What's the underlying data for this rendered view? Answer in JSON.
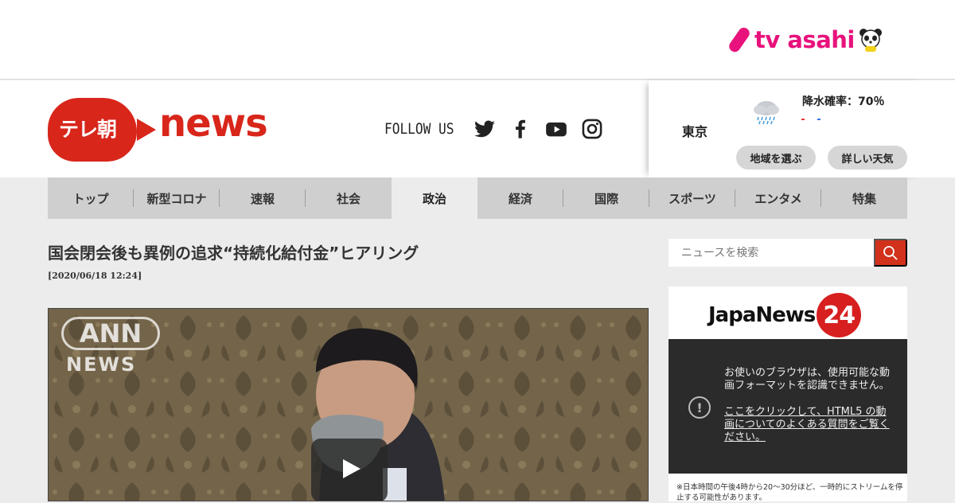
{
  "brand": {
    "tv_asahi": "tv asahi",
    "logo_blob": "テレ朝",
    "logo_news": "news"
  },
  "header": {
    "follow_us": "FOLLOW US",
    "social": [
      "twitter-icon",
      "facebook-icon",
      "youtube-icon",
      "instagram-icon"
    ]
  },
  "weather": {
    "city": "東京",
    "rain_probability": "降水確率：70％",
    "icon": "rain-cloud-icon",
    "select_region": "地域を選ぶ",
    "detail_weather": "詳しい天気"
  },
  "nav": {
    "items": [
      "トップ",
      "新型コロナ",
      "速報",
      "社会",
      "政治",
      "経済",
      "国際",
      "スポーツ",
      "エンタメ",
      "特集"
    ],
    "active": "政治"
  },
  "article": {
    "title": "国会閉会後も異例の追求“持続化給付金”ヒアリング",
    "date": "[2020/06/18 12:24]",
    "video_watermark_1": "ANN",
    "video_watermark_2": "NEWS"
  },
  "search": {
    "placeholder": "ニュースを検索"
  },
  "sidebar_player": {
    "logo_text": "JapaNews",
    "logo_badge": "24",
    "message": "お使いのブラウザは、使用可能な動画フォーマットを認識できません。",
    "link": "ここをクリックして、HTML5 の動画についてのよくある質問をご覧ください。",
    "note": "※日本時間の午後4時から20～30分ほど、一時的にストリームを停止する可能性があります。"
  },
  "colors": {
    "brand_red": "#d8261b",
    "tv_asahi_pink": "#e8127c",
    "nav_bg": "#cfcfcf",
    "search_button": "#d2311c"
  }
}
